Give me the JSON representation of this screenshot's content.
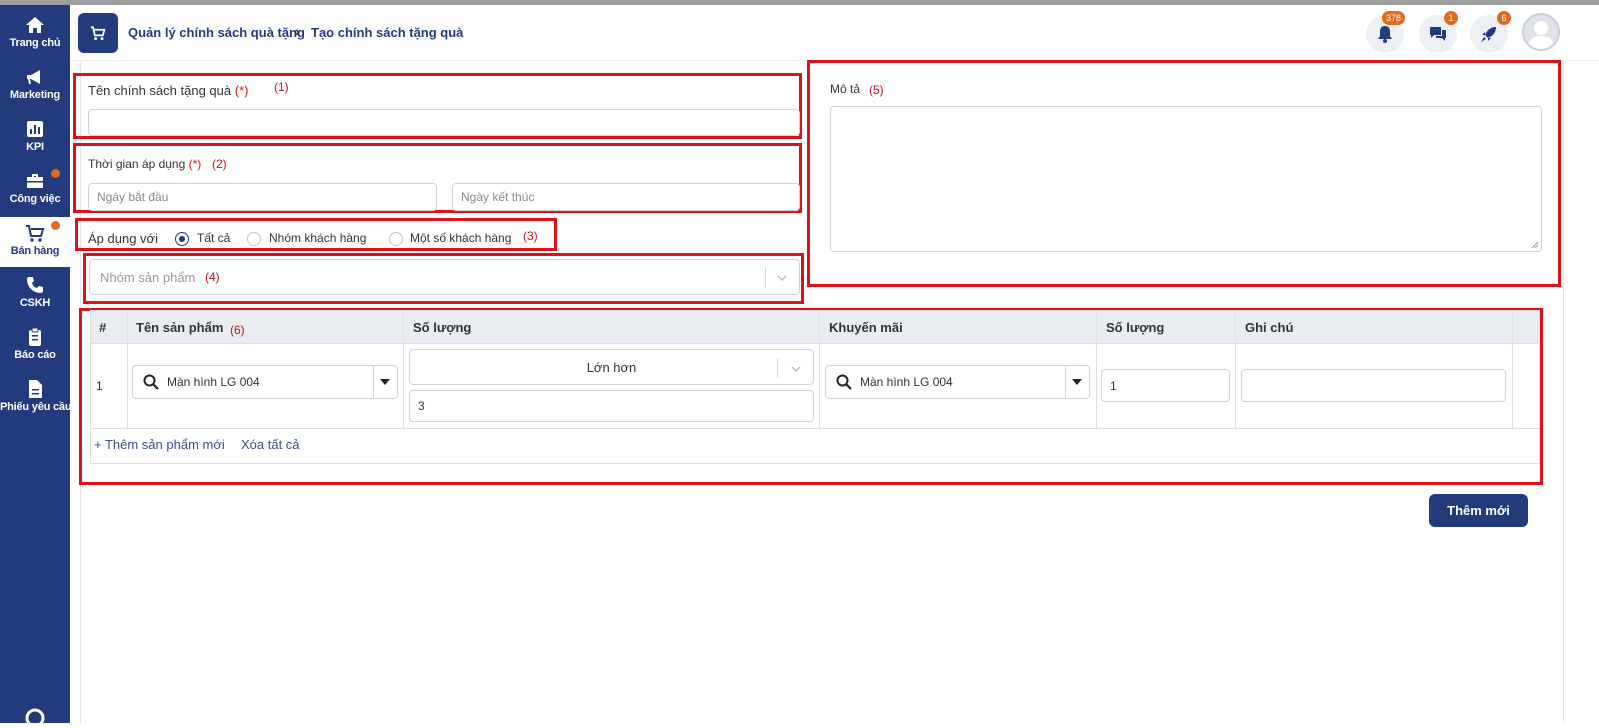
{
  "sidebar": {
    "items": [
      {
        "label": "Trang chủ",
        "icon": "home-icon"
      },
      {
        "label": "Marketing",
        "icon": "megaphone-icon"
      },
      {
        "label": "KPI",
        "icon": "chart-icon"
      },
      {
        "label": "Công việc",
        "icon": "briefcase-icon"
      },
      {
        "label": "Bán hàng",
        "icon": "cart-icon"
      },
      {
        "label": "CSKH",
        "icon": "phone-icon"
      },
      {
        "label": "Báo cáo",
        "icon": "clipboard-icon"
      },
      {
        "label": "Phiếu yêu cầu",
        "icon": "document-icon"
      }
    ]
  },
  "header": {
    "breadcrumb_parent": "Quản lý chính sách quà tặng",
    "breadcrumb_current": "Tạo chính sách tặng quà",
    "notifications_count": "378",
    "messages_count": "1",
    "rocket_count": "6"
  },
  "form": {
    "name_label": "Tên chính sách tặng quà",
    "required_mark": "(*)",
    "time_label": "Thời gian áp dụng",
    "start_placeholder": "Ngày bắt đầu",
    "end_placeholder": "Ngày kết thúc",
    "apply_label": "Áp dụng với",
    "apply_options": [
      "Tất cả",
      "Nhóm khách hàng",
      "Một số khách hàng"
    ],
    "product_group_placeholder": "Nhóm sản phẩm",
    "description_label": "Mô tả"
  },
  "annotations": [
    "(1)",
    "(2)",
    "(3)",
    "(4)",
    "(5)",
    "(6)"
  ],
  "table": {
    "columns": [
      "#",
      "Tên sản phẩm",
      "Số lượng",
      "Khuyến mãi",
      "Số lượng",
      "Ghi chú"
    ],
    "rows": [
      {
        "index": "1",
        "product": "Màn hình LG 004",
        "condition": "Lớn hơn",
        "quantity": "3",
        "promotion": "Màn hình LG 004",
        "promo_quantity": "1",
        "note": ""
      }
    ],
    "add_product": "+ Thêm sản phẩm mới",
    "clear_all": "Xóa tất cả"
  },
  "actions": {
    "submit": "Thêm mới"
  }
}
